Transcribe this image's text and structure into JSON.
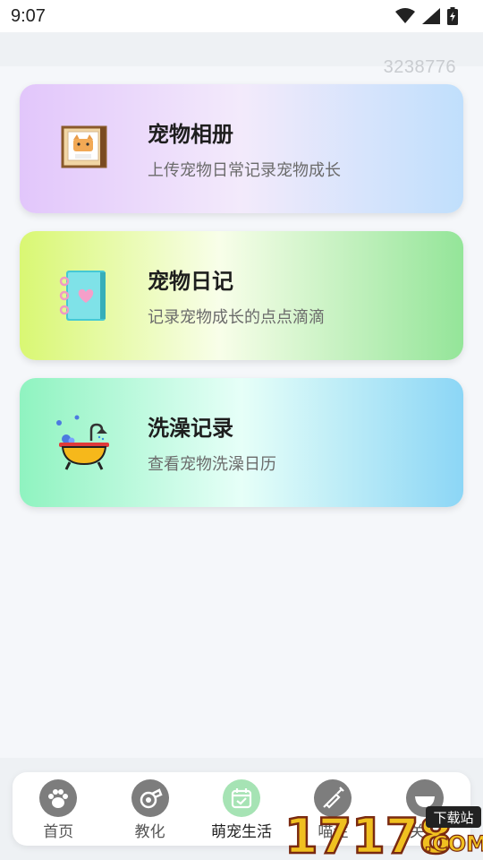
{
  "status": {
    "time": "9:07",
    "icons": [
      "wifi-icon",
      "signal-icon",
      "battery-icon"
    ]
  },
  "counter": "3238776",
  "cards": [
    {
      "id": "album",
      "title": "宠物相册",
      "subtitle": "上传宠物日常记录宠物成长",
      "icon": "cat-photo-icon"
    },
    {
      "id": "diary",
      "title": "宠物日记",
      "subtitle": "记录宠物成长的点点滴滴",
      "icon": "notebook-icon"
    },
    {
      "id": "bath",
      "title": "洗澡记录",
      "subtitle": "查看宠物洗澡日历",
      "icon": "bathtub-icon"
    }
  ],
  "nav": {
    "items": [
      {
        "label": "首页",
        "icon": "paw-icon",
        "active": false
      },
      {
        "label": "教化",
        "icon": "whistle-icon",
        "active": false
      },
      {
        "label": "萌宠生活",
        "icon": "calendar-icon",
        "active": true
      },
      {
        "label": "喵注",
        "icon": "syringe-icon",
        "active": false
      },
      {
        "label": "关于",
        "icon": "bowl-icon",
        "active": false
      }
    ]
  },
  "watermark": {
    "brand": "17178",
    "tag": "下载站",
    "domain": ".COM"
  },
  "colors": {
    "active_nav": "#a6e3b4",
    "inactive_nav": "#7d7d7d"
  }
}
